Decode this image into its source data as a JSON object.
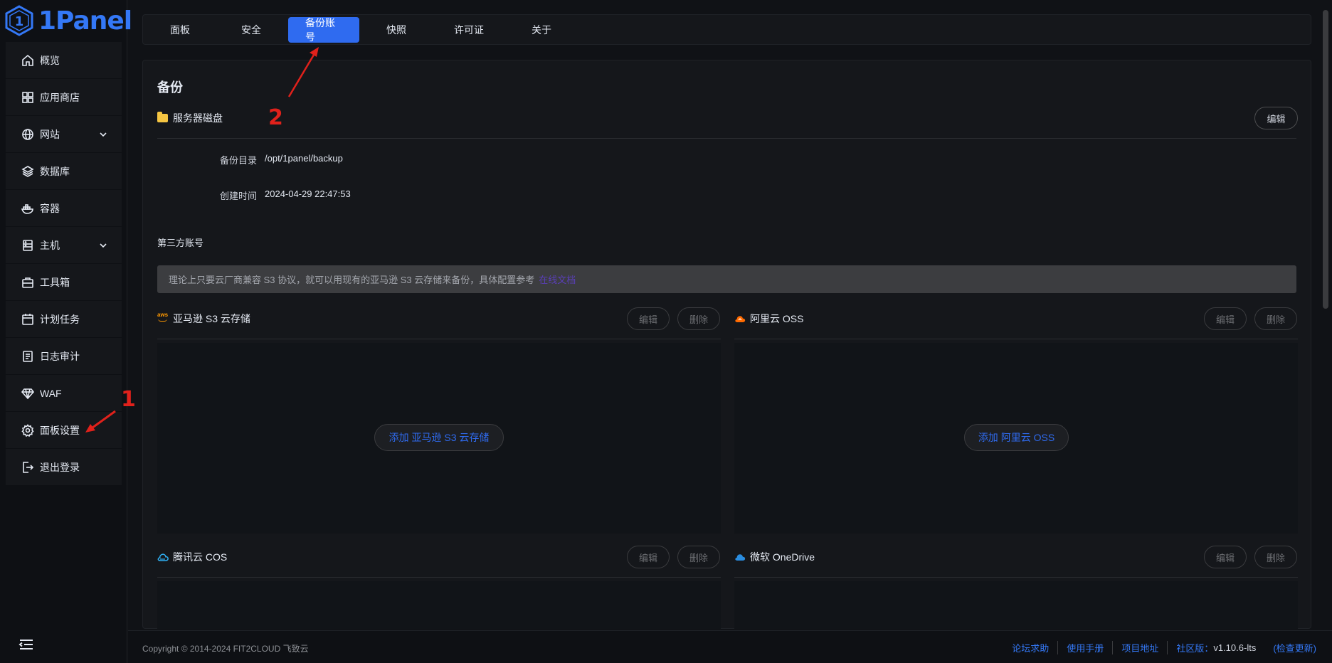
{
  "app": {
    "logo_text": "1Panel",
    "brand_color": "#3478f6"
  },
  "sidebar": {
    "items": [
      {
        "label": "概览",
        "icon": "home-icon"
      },
      {
        "label": "应用商店",
        "icon": "grid-icon"
      },
      {
        "label": "网站",
        "icon": "globe-icon",
        "expandable": true
      },
      {
        "label": "数据库",
        "icon": "layers-icon"
      },
      {
        "label": "容器",
        "icon": "docker-icon"
      },
      {
        "label": "主机",
        "icon": "server-icon",
        "expandable": true
      },
      {
        "label": "工具箱",
        "icon": "toolbox-icon"
      },
      {
        "label": "计划任务",
        "icon": "calendar-icon"
      },
      {
        "label": "日志审计",
        "icon": "log-icon"
      },
      {
        "label": "WAF",
        "icon": "diamond-icon"
      },
      {
        "label": "面板设置",
        "icon": "gear-icon"
      },
      {
        "label": "退出登录",
        "icon": "logout-icon"
      }
    ]
  },
  "tabs": [
    {
      "label": "面板",
      "active": false
    },
    {
      "label": "安全",
      "active": false
    },
    {
      "label": "备份账号",
      "active": true
    },
    {
      "label": "快照",
      "active": false
    },
    {
      "label": "许可证",
      "active": false
    },
    {
      "label": "关于",
      "active": false
    }
  ],
  "backup": {
    "title": "备份",
    "local": {
      "label": "服务器磁盘",
      "edit_label": "编辑",
      "dir_label": "备份目录",
      "dir_value": "/opt/1panel/backup",
      "created_label": "创建时间",
      "created_value": "2024-04-29 22:47:53"
    },
    "third_party_title": "第三方账号",
    "notice": "理论上只要云厂商兼容 S3 协议，就可以用现有的亚马逊 S3 云存储来备份，具体配置参考",
    "notice_link": "在线文档",
    "providers": [
      {
        "name": "亚马逊 S3 云存储",
        "edit": "编辑",
        "delete": "删除",
        "add": "添加 亚马逊 S3 云存储",
        "icon": "aws-icon"
      },
      {
        "name": "阿里云 OSS",
        "edit": "编辑",
        "delete": "删除",
        "add": "添加 阿里云 OSS",
        "icon": "aliyun-icon"
      },
      {
        "name": "腾讯云 COS",
        "edit": "编辑",
        "delete": "删除",
        "icon": "tencent-cloud-icon"
      },
      {
        "name": "微软 OneDrive",
        "edit": "编辑",
        "delete": "删除",
        "icon": "onedrive-icon"
      }
    ]
  },
  "footer": {
    "copyright": "Copyright © 2014-2024 FIT2CLOUD 飞致云",
    "links": [
      "论坛求助",
      "使用手册",
      "项目地址"
    ],
    "edition": "社区版：",
    "version": "v1.10.6-lts",
    "check_update": "(检查更新)"
  },
  "annotations": {
    "step1": "1",
    "step2": "2",
    "color": "#e0211b"
  }
}
